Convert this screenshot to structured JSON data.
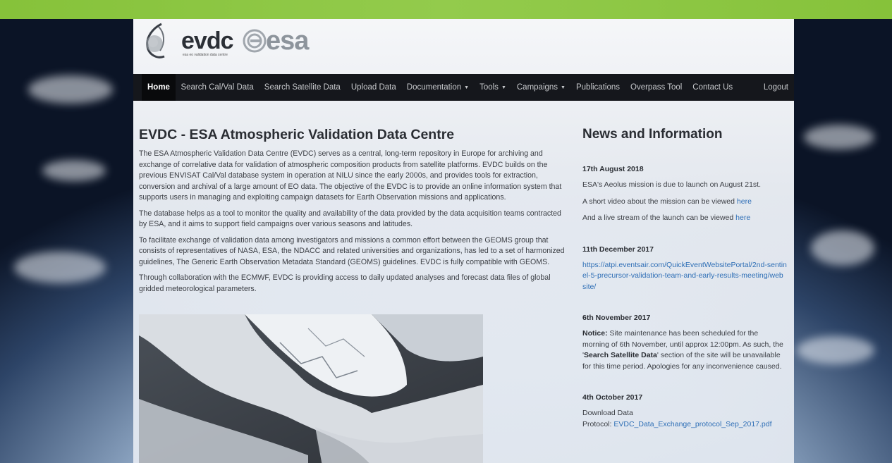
{
  "header": {
    "logo_evdc": "evdc",
    "logo_tagline": "esa eo validation data centre",
    "logo_esa": "esa"
  },
  "nav": {
    "items": [
      {
        "label": "Home",
        "dropdown": false,
        "active": true
      },
      {
        "label": "Search Cal/Val Data",
        "dropdown": false
      },
      {
        "label": "Search Satellite Data",
        "dropdown": false
      },
      {
        "label": "Upload Data",
        "dropdown": false
      },
      {
        "label": "Documentation",
        "dropdown": true
      },
      {
        "label": "Tools",
        "dropdown": true
      },
      {
        "label": "Campaigns",
        "dropdown": true
      },
      {
        "label": "Publications",
        "dropdown": false
      },
      {
        "label": "Overpass Tool",
        "dropdown": false
      },
      {
        "label": "Contact Us",
        "dropdown": false
      }
    ],
    "logout": "Logout",
    "caret": "▼"
  },
  "main": {
    "title": "EVDC - ESA Atmospheric Validation Data Centre",
    "paragraphs": [
      "The ESA Atmospheric Validation Data Centre (EVDC) serves as a central, long-term repository in Europe for archiving and exchange of correlative data for validation of atmospheric composition products from satellite platforms. EVDC builds on the previous ENVISAT Cal/Val database system in operation at NILU since the early 2000s, and provides tools for extraction, conversion and archival of a large amount of EO data. The objective of the EVDC is to provide an online information system that supports users in managing and exploiting campaign datasets for Earth Observation missions and applications.",
      "The database helps as a tool to monitor the quality and availability of the data provided by the data acquisition teams contracted by ESA, and it aims to support field campaigns over various seasons and latitudes.",
      "To facilitate exchange of validation data among investigators and missions a common effort between the GEOMS group that consists of representatives of NASA, ESA, the NDACC and related universities and organizations, has led to a set of harmonized guidelines, The Generic Earth Observation Metadata Standard (GEOMS) guidelines. EVDC is fully compatible with GEOMS.",
      "Through collaboration with the ECMWF, EVDC is providing access to daily updated analyses and forecast data files of global gridded meteorological parameters."
    ]
  },
  "news": {
    "title": "News and Information",
    "item1": {
      "date": "17th August 2018",
      "line1": "ESA's Aeolus mission is due to launch on August 21st.",
      "line2_text": "A short video about the mission can be viewed ",
      "line2_link": "here",
      "line3_text": "And a live stream of the launch can be viewed ",
      "line3_link": "here"
    },
    "item2": {
      "date": "11th December 2017",
      "link": "https://atpi.eventsair.com/QuickEventWebsitePortal/2nd-sentinel-5-precursor-validation-team-and-early-results-meeting/website/"
    },
    "item3": {
      "date": "6th November 2017",
      "notice_label": "Notice:",
      "text1": " Site maintenance has been scheduled for the morning of 6th November, until approx 12:00pm. As such, the '",
      "bold": "Search Satellite Data",
      "text2": "' section of the site will be unavailable for this time period. Apologies for any inconvenience caused."
    },
    "item4": {
      "date": "4th October 2017",
      "line1": "Download Data",
      "protocol_label": "Protocol: ",
      "protocol_link": "EVDC_Data_Exchange_protocol_Sep_2017.pdf"
    }
  }
}
